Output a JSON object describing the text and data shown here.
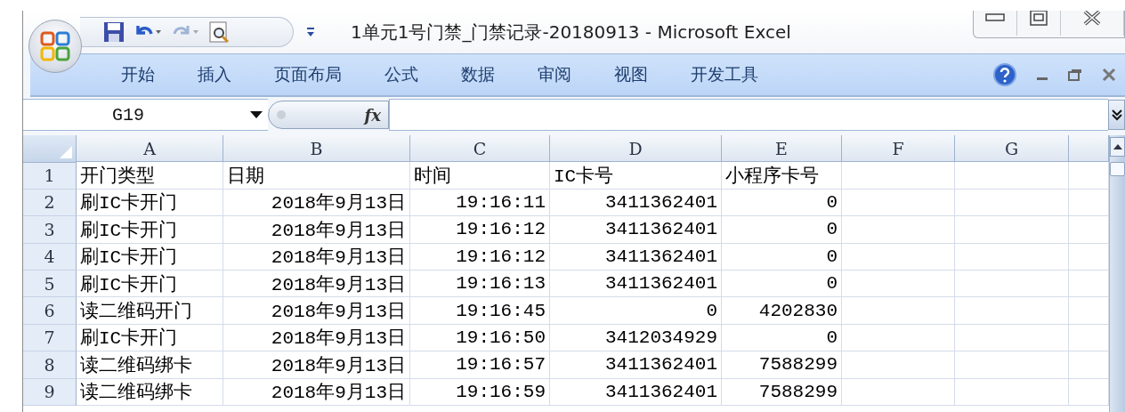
{
  "window": {
    "title": "1单元1号门禁_门禁记录-20180913 - Microsoft Excel"
  },
  "ribbon_tabs": [
    {
      "label": "开始",
      "selected": false
    },
    {
      "label": "插入",
      "selected": false
    },
    {
      "label": "页面布局",
      "selected": false
    },
    {
      "label": "公式",
      "selected": false
    },
    {
      "label": "数据",
      "selected": false
    },
    {
      "label": "审阅",
      "selected": false
    },
    {
      "label": "视图",
      "selected": false
    },
    {
      "label": "开发工具",
      "selected": false
    }
  ],
  "formula_bar": {
    "name_box": "G19",
    "fx": "fx"
  },
  "sheet": {
    "columns": [
      "A",
      "B",
      "C",
      "D",
      "E",
      "F",
      "G"
    ],
    "rows": [
      {
        "number": "1",
        "cells": [
          {
            "text": "开门类型"
          },
          {
            "text": "日期"
          },
          {
            "text": "时间"
          },
          {
            "text": "IC卡号"
          },
          {
            "text": "小程序卡号"
          }
        ]
      },
      {
        "number": "2",
        "cells": [
          {
            "text": "刷IC卡开门"
          },
          {
            "text": "2018年9月13日"
          },
          {
            "text": "19:16:11"
          },
          {
            "text": "3411362401"
          },
          {
            "text": "0"
          }
        ]
      },
      {
        "number": "3",
        "cells": [
          {
            "text": "刷IC卡开门"
          },
          {
            "text": "2018年9月13日"
          },
          {
            "text": "19:16:12"
          },
          {
            "text": "3411362401"
          },
          {
            "text": "0"
          }
        ]
      },
      {
        "number": "4",
        "cells": [
          {
            "text": "刷IC卡开门"
          },
          {
            "text": "2018年9月13日"
          },
          {
            "text": "19:16:12"
          },
          {
            "text": "3411362401"
          },
          {
            "text": "0"
          }
        ]
      },
      {
        "number": "5",
        "cells": [
          {
            "text": "刷IC卡开门"
          },
          {
            "text": "2018年9月13日"
          },
          {
            "text": "19:16:13"
          },
          {
            "text": "3411362401"
          },
          {
            "text": "0"
          }
        ]
      },
      {
        "number": "6",
        "cells": [
          {
            "text": "读二维码开门"
          },
          {
            "text": "2018年9月13日"
          },
          {
            "text": "19:16:45"
          },
          {
            "text": "0"
          },
          {
            "text": "4202830"
          }
        ]
      },
      {
        "number": "7",
        "cells": [
          {
            "text": "刷IC卡开门"
          },
          {
            "text": "2018年9月13日"
          },
          {
            "text": "19:16:50"
          },
          {
            "text": "3412034929"
          },
          {
            "text": "0"
          }
        ]
      },
      {
        "number": "8",
        "cells": [
          {
            "text": "读二维码绑卡"
          },
          {
            "text": "2018年9月13日"
          },
          {
            "text": "19:16:57"
          },
          {
            "text": "3411362401"
          },
          {
            "text": "7588299"
          }
        ]
      },
      {
        "number": "9",
        "cells": [
          {
            "text": "读二维码绑卡"
          },
          {
            "text": "2018年9月13日"
          },
          {
            "text": "19:16:59"
          },
          {
            "text": "3411362401"
          },
          {
            "text": "7588299"
          }
        ]
      }
    ]
  }
}
